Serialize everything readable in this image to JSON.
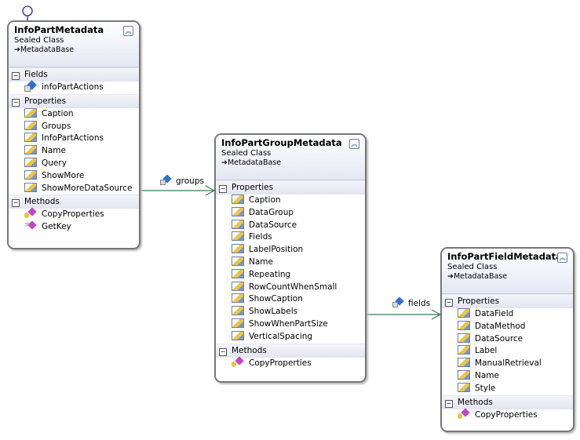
{
  "classes": [
    {
      "id": "info-part-metadata",
      "title": "InfoPartMetadata",
      "kind": "Sealed Class",
      "base": "MetadataBase",
      "sections": [
        {
          "label": "Fields",
          "items": [
            {
              "name": "infoPartActions",
              "icon": "field"
            }
          ]
        },
        {
          "label": "Properties",
          "items": [
            {
              "name": "Caption",
              "icon": "prop"
            },
            {
              "name": "Groups",
              "icon": "prop"
            },
            {
              "name": "InfoPartActions",
              "icon": "prop"
            },
            {
              "name": "Name",
              "icon": "prop"
            },
            {
              "name": "Query",
              "icon": "prop"
            },
            {
              "name": "ShowMore",
              "icon": "prop"
            },
            {
              "name": "ShowMoreDataSource",
              "icon": "prop"
            }
          ]
        },
        {
          "label": "Methods",
          "items": [
            {
              "name": "CopyProperties",
              "icon": "method"
            },
            {
              "name": "GetKey",
              "icon": "methodp"
            }
          ]
        }
      ]
    },
    {
      "id": "info-part-group-metadata",
      "title": "InfoPartGroupMetadata",
      "kind": "Sealed Class",
      "base": "MetadataBase",
      "sections": [
        {
          "label": "Properties",
          "items": [
            {
              "name": "Caption",
              "icon": "prop"
            },
            {
              "name": "DataGroup",
              "icon": "prop"
            },
            {
              "name": "DataSource",
              "icon": "prop"
            },
            {
              "name": "Fields",
              "icon": "prop"
            },
            {
              "name": "LabelPosition",
              "icon": "prop"
            },
            {
              "name": "Name",
              "icon": "prop"
            },
            {
              "name": "Repeating",
              "icon": "prop"
            },
            {
              "name": "RowCountWhenSmall",
              "icon": "prop"
            },
            {
              "name": "ShowCaption",
              "icon": "prop"
            },
            {
              "name": "ShowLabels",
              "icon": "prop"
            },
            {
              "name": "ShowWhenPartSize",
              "icon": "prop"
            },
            {
              "name": "VerticalSpacing",
              "icon": "prop"
            }
          ]
        },
        {
          "label": "Methods",
          "items": [
            {
              "name": "CopyProperties",
              "icon": "method"
            }
          ]
        }
      ]
    },
    {
      "id": "info-part-field-metadata",
      "title": "InfoPartFieldMetadata",
      "kind": "Sealed Class",
      "base": "MetadataBase",
      "sections": [
        {
          "label": "Properties",
          "items": [
            {
              "name": "DataField",
              "icon": "prop"
            },
            {
              "name": "DataMethod",
              "icon": "prop"
            },
            {
              "name": "DataSource",
              "icon": "prop"
            },
            {
              "name": "Label",
              "icon": "prop"
            },
            {
              "name": "ManualRetrieval",
              "icon": "prop"
            },
            {
              "name": "Name",
              "icon": "prop"
            },
            {
              "name": "Style",
              "icon": "prop"
            }
          ]
        },
        {
          "label": "Methods",
          "items": [
            {
              "name": "CopyProperties",
              "icon": "method"
            }
          ]
        }
      ]
    }
  ],
  "associations": [
    {
      "from": "InfoPartMetadata",
      "to": "InfoPartGroupMetadata",
      "label": "groups"
    },
    {
      "from": "InfoPartGroupMetadata",
      "to": "InfoPartFieldMetadata",
      "label": "fields"
    }
  ],
  "colors": {
    "connector": "#3d7a4d",
    "border": "#777777",
    "header": "#e4e8f4"
  }
}
